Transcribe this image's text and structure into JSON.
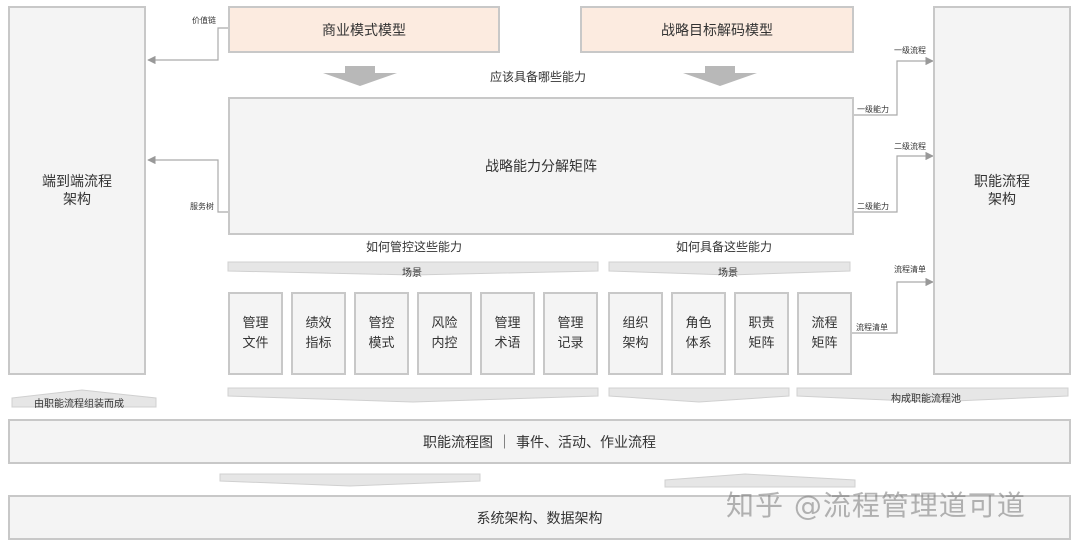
{
  "left_panel": {
    "title": "端到端流程\n架构"
  },
  "right_panel": {
    "title": "职能流程\n架构"
  },
  "top_boxes": {
    "business_model": "商业模式模型",
    "strategy_decode": "战略目标解码模型"
  },
  "question_capabilities": "应该具备哪些能力",
  "matrix": {
    "title": "战略能力分解矩阵"
  },
  "left_links": {
    "value_chain": "价值链",
    "service_tree": "服务树"
  },
  "right_links": {
    "level1_capability": "一级能力",
    "level1_process": "一级流程",
    "level2_capability": "二级能力",
    "level2_process": "二级流程",
    "process_list_out": "流程清单",
    "process_list_in": "流程清单"
  },
  "how_control": "如何管控这些能力",
  "how_acquire": "如何具备这些能力",
  "scene_left": "场景",
  "scene_right": "场景",
  "control_cells": [
    "管理\n文件",
    "绩效\n指标",
    "管控\n模式",
    "风险\n内控",
    "管理\n术语",
    "管理\n记录"
  ],
  "acquire_cells": [
    "组织\n架构",
    "角色\n体系",
    "职责\n矩阵",
    "流程\n矩阵"
  ],
  "assembled_from": "由职能流程组装而成",
  "forms_pool": "构成职能流程池",
  "functional_flow": "职能流程图 ｜ 事件、活动、作业流程",
  "system_arch": "系统架构、数据架构",
  "watermark": "知乎 @流程管理道可道"
}
